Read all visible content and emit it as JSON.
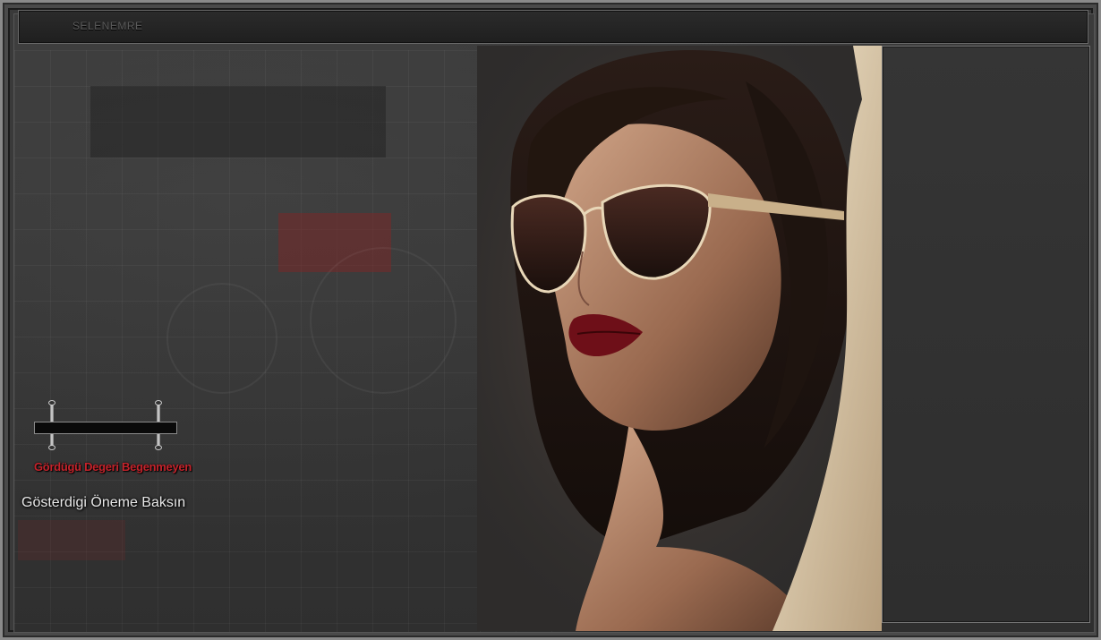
{
  "header": {
    "title": "SELENEMRE"
  },
  "captions": {
    "line1": "Gördügü Degeri Begenmeyen",
    "line2": "Gösterdigi Öneme Baksın"
  },
  "colors": {
    "frame": "#8a8a8a",
    "background": "#383838",
    "caption_red": "#c4232b",
    "caption_white": "#e8e8e8"
  },
  "photo": {
    "subject": "woman-with-sunglasses"
  }
}
